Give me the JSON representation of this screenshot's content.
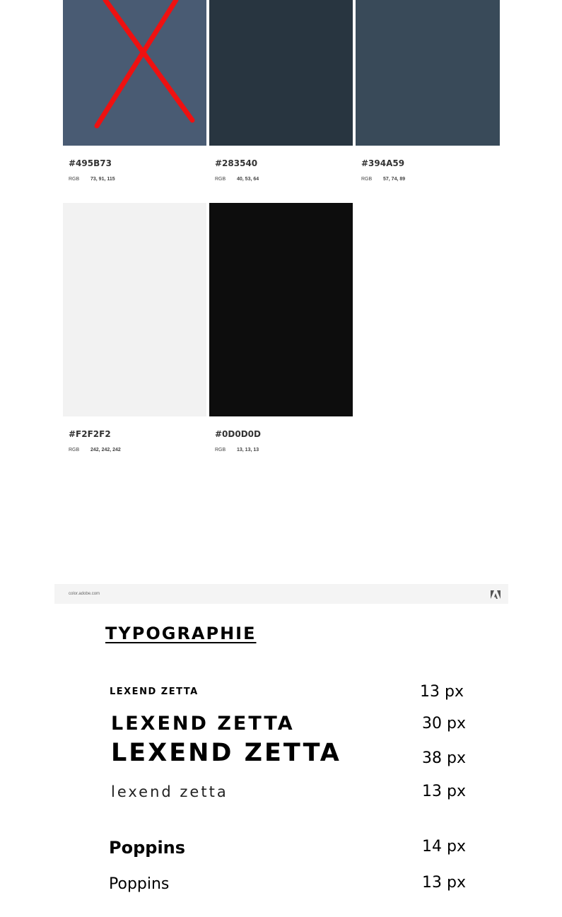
{
  "palette": {
    "row1": [
      {
        "hex": "#495B73",
        "rgb_label": "RGB",
        "rgb": "73, 91, 115",
        "color": "#495B73",
        "crossed_out": true
      },
      {
        "hex": "#283540",
        "rgb_label": "RGB",
        "rgb": "40, 53, 64",
        "color": "#283540",
        "crossed_out": false
      },
      {
        "hex": "#394A59",
        "rgb_label": "RGB",
        "rgb": "57, 74, 89",
        "color": "#394A59",
        "crossed_out": false
      }
    ],
    "row2": [
      {
        "hex": "#F2F2F2",
        "rgb_label": "RGB",
        "rgb": "242, 242, 242",
        "color": "#F2F2F2"
      },
      {
        "hex": "#0D0D0D",
        "rgb_label": "RGB",
        "rgb": "13, 13, 13",
        "color": "#0D0D0D"
      }
    ],
    "cross_color": "#ee1111"
  },
  "footer": {
    "site": "color.adobe.com",
    "logo_icon": "adobe-logo-icon"
  },
  "typography": {
    "title": "TYPOGRAPHIE",
    "samples": [
      {
        "text": "LEXEND ZETTA",
        "size": "13 px"
      },
      {
        "text": "LEXEND ZETTA",
        "size": "30 px"
      },
      {
        "text": "LEXEND ZETTA",
        "size": "38 px"
      },
      {
        "text": "lexend zetta",
        "size": "13 px"
      },
      {
        "text": "Poppins",
        "size": "14 px"
      },
      {
        "text": "Poppins",
        "size": "13 px"
      }
    ]
  }
}
